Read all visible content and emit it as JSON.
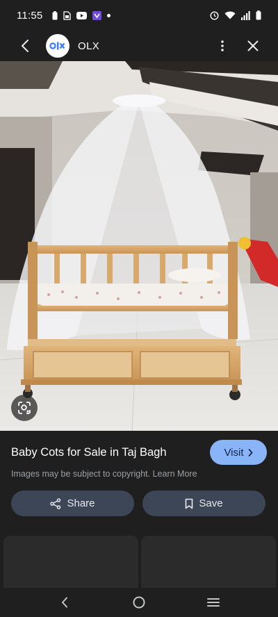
{
  "status_bar": {
    "time": "11:55",
    "left_icons": [
      "battery-saver-icon",
      "sim-icon",
      "youtube-icon",
      "app-icon",
      "dot-icon"
    ],
    "right_icons": [
      "alarm-icon",
      "wifi-icon",
      "signal-icon",
      "battery-icon"
    ]
  },
  "app_bar": {
    "site_name": "OLX",
    "logo_text": "olx"
  },
  "image": {
    "subject": "crib-with-mosquito-net"
  },
  "result": {
    "title": "Baby Cots for Sale in Taj Bagh",
    "visit_label": "Visit",
    "copyright_text": "Images may be subject to copyright.",
    "learn_more": "Learn More",
    "share_label": "Share",
    "save_label": "Save"
  },
  "colors": {
    "background": "#1f1f1f",
    "accent": "#8ab4f8",
    "button_bg": "#3c4656"
  }
}
